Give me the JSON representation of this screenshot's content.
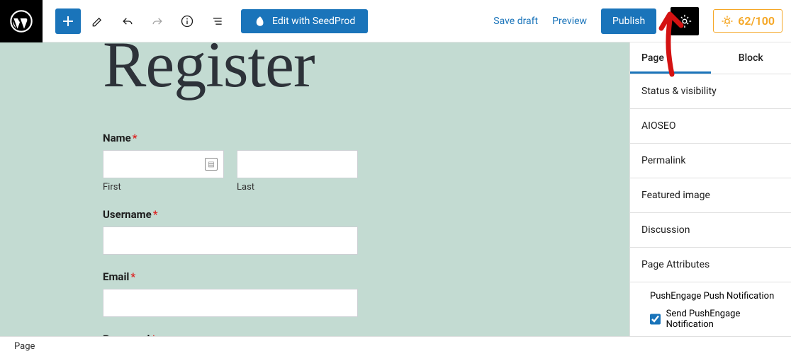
{
  "toolbar": {
    "seedprod_label": "Edit with SeedProd",
    "save_draft": "Save draft",
    "preview": "Preview",
    "publish": "Publish",
    "score": "62/100"
  },
  "page": {
    "title": "Register"
  },
  "form": {
    "name": {
      "label": "Name",
      "first": "First",
      "last": "Last"
    },
    "username": {
      "label": "Username"
    },
    "email": {
      "label": "Email"
    },
    "password": {
      "label": "Password"
    }
  },
  "sidebar": {
    "tabs": {
      "page": "Page",
      "block": "Block"
    },
    "sections": {
      "status": "Status & visibility",
      "aioseo": "AIOSEO",
      "permalink": "Permalink",
      "featured": "Featured image",
      "discussion": "Discussion",
      "attributes": "Page Attributes",
      "pushengage_heading": "PushEngage Push Notification",
      "pushengage_check": "Send PushEngage Notification"
    }
  },
  "bottom": {
    "crumb": "Page"
  }
}
